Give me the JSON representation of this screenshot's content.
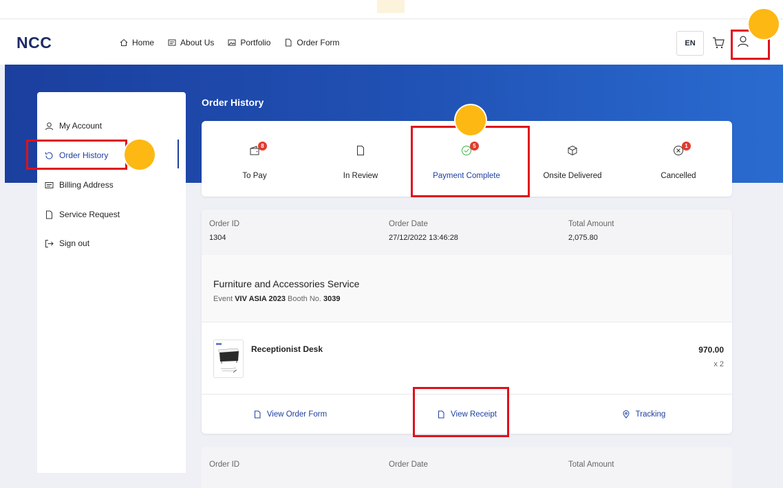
{
  "brand": {
    "logo": "NCC"
  },
  "nav": [
    {
      "label": "Home",
      "icon": "home-icon"
    },
    {
      "label": "About Us",
      "icon": "id-card-icon"
    },
    {
      "label": "Portfolio",
      "icon": "image-icon"
    },
    {
      "label": "Order Form",
      "icon": "file-icon"
    }
  ],
  "header": {
    "language": "EN"
  },
  "sidebar": {
    "items": [
      {
        "label": "My Account",
        "icon": "user-icon"
      },
      {
        "label": "Order History",
        "icon": "history-icon",
        "active": true
      },
      {
        "label": "Billing Address",
        "icon": "id-card-icon"
      },
      {
        "label": "Service Request",
        "icon": "file-icon"
      },
      {
        "label": "Sign out",
        "icon": "sign-out-icon"
      }
    ]
  },
  "page": {
    "title": "Order History"
  },
  "status_tabs": [
    {
      "label": "To Pay",
      "badge": "8",
      "icon": "wallet-icon"
    },
    {
      "label": "In Review",
      "badge": "",
      "icon": "file-icon"
    },
    {
      "label": "Payment Complete",
      "badge": "5",
      "icon": "check-circle-icon",
      "active": true
    },
    {
      "label": "Onsite Delivered",
      "badge": "",
      "icon": "box-icon"
    },
    {
      "label": "Cancelled",
      "badge": "1",
      "icon": "x-circle-icon"
    }
  ],
  "order": {
    "id_label": "Order ID",
    "id": "1304",
    "date_label": "Order Date",
    "date": "27/12/2022 13:46:28",
    "total_label": "Total Amount",
    "total": "2,075.80",
    "service": "Furniture and Accessories Service",
    "event_label": "Event",
    "event": "VIV ASIA 2023",
    "booth_label": "Booth No.",
    "booth": "3039",
    "item": {
      "name": "Receptionist Desk",
      "price": "970.00",
      "qty": "x 2"
    },
    "actions": {
      "view_order_form": "View Order Form",
      "view_receipt": "View Receipt",
      "tracking": "Tracking"
    }
  },
  "order2": {
    "id_label": "Order ID",
    "date_label": "Order Date",
    "total_label": "Total Amount"
  },
  "colors": {
    "accent": "#1d3fa0",
    "highlight": "#e0101a",
    "marker": "#fdb813",
    "badge": "#e23b2e",
    "hero": "#2050b3"
  }
}
